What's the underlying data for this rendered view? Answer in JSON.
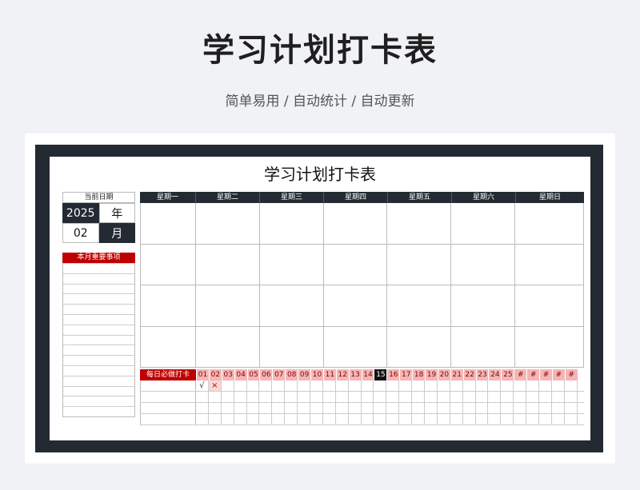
{
  "header": {
    "title": "学习计划打卡表",
    "subtitle": "简单易用 / 自动统计 / 自动更新"
  },
  "sheet": {
    "title": "学习计划打卡表",
    "current_date_label": "当前日期",
    "year_value": "2025",
    "year_unit": "年",
    "month_value": "02",
    "month_unit": "月",
    "events_label": "本月重要事项",
    "weekdays": [
      "星期一",
      "星期二",
      "星期三",
      "星期四",
      "星期五",
      "星期六",
      "星期日"
    ],
    "checkin_label": "每日必做打卡",
    "days": [
      "01",
      "02",
      "03",
      "04",
      "05",
      "06",
      "07",
      "08",
      "09",
      "10",
      "11",
      "12",
      "13",
      "14",
      "15",
      "16",
      "17",
      "18",
      "19",
      "20",
      "21",
      "22",
      "23",
      "24",
      "25",
      "#",
      "#",
      "#",
      "#",
      "#"
    ],
    "today_index": 14,
    "marks": {
      "check": "√",
      "cross": "×"
    }
  },
  "colors": {
    "dark": "#232a32",
    "red": "#c00000",
    "pink": "#f4b6b6"
  }
}
